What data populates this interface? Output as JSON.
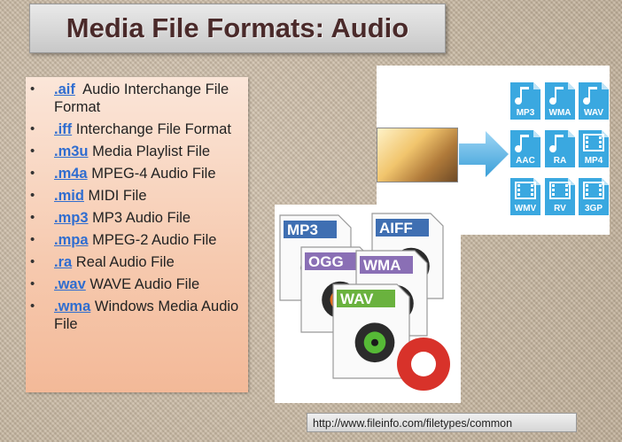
{
  "title": "Media File Formats: Audio",
  "formats": [
    {
      "ext": ".aif",
      "desc": "Audio Interchange File Format",
      "lead_space": true
    },
    {
      "ext": ".iff",
      "desc": "Interchange File Format"
    },
    {
      "ext": ".m3u",
      "desc": "Media Playlist File"
    },
    {
      "ext": ".m4a",
      "desc": "MPEG-4 Audio File"
    },
    {
      "ext": ".mid",
      "desc": "MIDI File"
    },
    {
      "ext": ".mp3",
      "desc": "MP3 Audio File"
    },
    {
      "ext": ".mpa",
      "desc": "MPEG-2 Audio File"
    },
    {
      "ext": ".ra",
      "desc": "Real Audio File"
    },
    {
      "ext": ".wav",
      "desc": "WAVE Audio File"
    },
    {
      "ext": ".wma",
      "desc": "Windows Media Audio File"
    }
  ],
  "icon_grid": {
    "audio": [
      "MP3",
      "WMA",
      "WAV",
      "AAC",
      "RA"
    ],
    "video": [
      "MP4",
      "WMV",
      "RV",
      "3GP"
    ]
  },
  "stack_labels": [
    "MP3",
    "AIFF",
    "OGG",
    "WMA",
    "WAV"
  ],
  "url": "http://www.fileinfo.com/filetypes/common",
  "colors": {
    "link": "#2f6dd0",
    "icon_blue": "#3aa8e0",
    "title_text": "#4a2a2a",
    "cd_green": "#56b936",
    "record_red": "#d8322a"
  }
}
